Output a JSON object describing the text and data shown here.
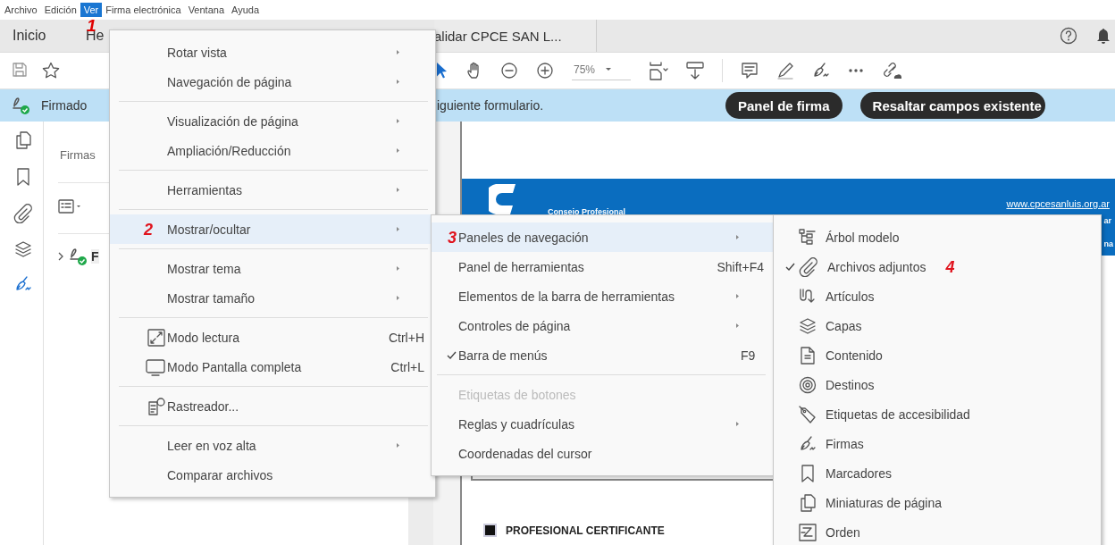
{
  "menubar": {
    "items": [
      {
        "label": "Archivo",
        "selected": false
      },
      {
        "label": "Edición",
        "selected": false
      },
      {
        "label": "Ver",
        "selected": true
      },
      {
        "label": "Firma electrónica",
        "selected": false
      },
      {
        "label": "Ventana",
        "selected": false
      },
      {
        "label": "Ayuda",
        "selected": false
      }
    ],
    "annotation": "1"
  },
  "tabs": [
    {
      "label": "Inicio",
      "selected": false
    },
    {
      "label": "He",
      "selected": false
    },
    {
      "label": "alidar CPCE SAN L...",
      "selected": true
    }
  ],
  "toolbar": {
    "zoom": "75%"
  },
  "banner": {
    "status": "Firmado",
    "message": "iguiente formulario.",
    "buttons": [
      "Panel de firma",
      "Resaltar campos existente"
    ]
  },
  "side_panel": {
    "title": "Firmas",
    "signature": "F"
  },
  "document": {
    "organization": "Consejo Profesional",
    "website": "www.cpcesanluis.org.ar",
    "edge_texts": [
      "ar",
      "na"
    ],
    "section": "PROFESIONAL CERTIFICANTE"
  },
  "view_menu": {
    "items": [
      {
        "kind": "item",
        "label": "Rotar vista",
        "submenu": true,
        "selected": false
      },
      {
        "kind": "item",
        "label": "Navegación de página",
        "submenu": true,
        "selected": false
      },
      {
        "kind": "separator"
      },
      {
        "kind": "item",
        "label": "Visualización de página",
        "submenu": true,
        "selected": false
      },
      {
        "kind": "item",
        "label": "Ampliación/Reducción",
        "submenu": true,
        "selected": false
      },
      {
        "kind": "separator"
      },
      {
        "kind": "item",
        "label": "Herramientas",
        "submenu": true,
        "selected": false
      },
      {
        "kind": "separator"
      },
      {
        "kind": "item",
        "label": "Mostrar/ocultar",
        "submenu": true,
        "selected": true,
        "badge": "2"
      },
      {
        "kind": "separator"
      },
      {
        "kind": "item",
        "label": "Mostrar tema",
        "submenu": true,
        "selected": false
      },
      {
        "kind": "item",
        "label": "Mostrar tamaño",
        "submenu": true,
        "selected": false
      },
      {
        "kind": "separator"
      },
      {
        "kind": "icon_item",
        "label": "Modo lectura",
        "shortcut": "Ctrl+H",
        "submenu": false,
        "selected": false
      },
      {
        "kind": "icon_item",
        "label": "Modo Pantalla completa",
        "shortcut": "Ctrl+L",
        "submenu": false,
        "selected": false
      },
      {
        "kind": "separator"
      },
      {
        "kind": "icon_item",
        "label": "Rastreador...",
        "submenu": false,
        "selected": false
      },
      {
        "kind": "separator"
      },
      {
        "kind": "item",
        "label": "Leer en voz alta",
        "submenu": true,
        "selected": false
      },
      {
        "kind": "item",
        "label": "Comparar archivos",
        "submenu": false,
        "selected": false
      }
    ]
  },
  "show_hide_menu": {
    "items": [
      {
        "kind": "item",
        "label": "Paneles de navegación",
        "submenu": true,
        "selected": true,
        "checked": false,
        "disabled": false,
        "badge": "3"
      },
      {
        "kind": "item",
        "label": "Panel de herramientas",
        "shortcut": "Shift+F4",
        "submenu": false,
        "selected": false,
        "checked": false,
        "disabled": false
      },
      {
        "kind": "item",
        "label": "Elementos de la barra de herramientas",
        "submenu": true,
        "selected": false,
        "checked": false,
        "disabled": false
      },
      {
        "kind": "item",
        "label": "Controles de página",
        "submenu": true,
        "selected": false,
        "checked": false,
        "disabled": false
      },
      {
        "kind": "item",
        "label": "Barra de menús",
        "shortcut": "F9",
        "submenu": false,
        "selected": false,
        "checked": true,
        "disabled": false
      },
      {
        "kind": "separator"
      },
      {
        "kind": "item",
        "label": "Etiquetas de botones",
        "submenu": false,
        "selected": false,
        "checked": false,
        "disabled": true
      },
      {
        "kind": "item",
        "label": "Reglas y cuadrículas",
        "submenu": true,
        "selected": false,
        "checked": false,
        "disabled": false
      },
      {
        "kind": "item",
        "label": "Coordenadas del cursor",
        "submenu": false,
        "selected": false,
        "checked": false,
        "disabled": false
      }
    ]
  },
  "panels_menu": {
    "items": [
      {
        "label": "Árbol modelo",
        "checked": false
      },
      {
        "label": "Archivos adjuntos",
        "checked": true,
        "badge": "4"
      },
      {
        "label": "Artículos",
        "checked": false
      },
      {
        "label": "Capas",
        "checked": false
      },
      {
        "label": "Contenido",
        "checked": false
      },
      {
        "label": "Destinos",
        "checked": false
      },
      {
        "label": "Etiquetas de accesibilidad",
        "checked": false
      },
      {
        "label": "Firmas",
        "checked": false
      },
      {
        "label": "Marcadores",
        "checked": false
      },
      {
        "label": "Miniaturas de página",
        "checked": false
      },
      {
        "label": "Orden",
        "checked": false
      }
    ]
  }
}
